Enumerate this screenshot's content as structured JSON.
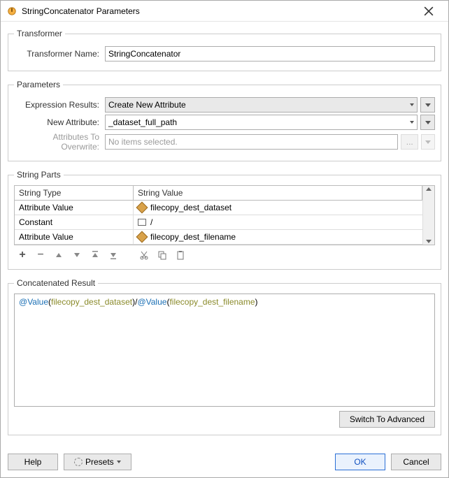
{
  "window": {
    "title": "StringConcatenator Parameters"
  },
  "transformer": {
    "legend": "Transformer",
    "name_label": "Transformer Name:",
    "name_value": "StringConcatenator"
  },
  "parameters": {
    "legend": "Parameters",
    "expr_label": "Expression Results:",
    "expr_value": "Create New Attribute",
    "newattr_label": "New Attribute:",
    "newattr_value": "_dataset_full_path",
    "overwrite_label": "Attributes To Overwrite:",
    "overwrite_value": "No items selected."
  },
  "string_parts": {
    "legend": "String Parts",
    "col_type": "String Type",
    "col_value": "String Value",
    "rows": [
      {
        "type": "Attribute Value",
        "icon": "attr",
        "value": "filecopy_dest_dataset"
      },
      {
        "type": "Constant",
        "icon": "const",
        "value": "/"
      },
      {
        "type": "Attribute Value",
        "icon": "attr",
        "value": "filecopy_dest_filename"
      }
    ],
    "toolbar": {
      "add": "+",
      "remove": "−",
      "up": "▲",
      "down": "▼",
      "top": "⤒",
      "bottom": "⤓",
      "cut": "✂",
      "copy": "⧉",
      "paste": "📋"
    }
  },
  "result": {
    "legend": "Concatenated Result",
    "tokens": [
      {
        "t": "at",
        "v": "@"
      },
      {
        "t": "fn",
        "v": "Value"
      },
      {
        "t": "sep",
        "v": "("
      },
      {
        "t": "arg",
        "v": "filecopy_dest_dataset"
      },
      {
        "t": "sep",
        "v": ")"
      },
      {
        "t": "sep",
        "v": "/"
      },
      {
        "t": "at",
        "v": "@"
      },
      {
        "t": "fn",
        "v": "Value"
      },
      {
        "t": "sep",
        "v": "("
      },
      {
        "t": "arg",
        "v": "filecopy_dest_filename"
      },
      {
        "t": "sep",
        "v": ")"
      }
    ]
  },
  "buttons": {
    "switch": "Switch To Advanced",
    "help": "Help",
    "presets": "Presets",
    "ok": "OK",
    "cancel": "Cancel"
  }
}
